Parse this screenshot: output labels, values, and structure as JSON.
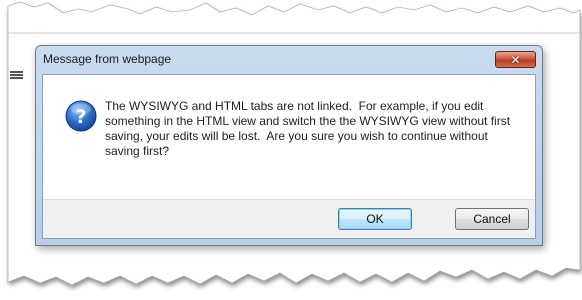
{
  "dialog": {
    "title": "Message from webpage",
    "close_glyph": "✕",
    "icon": "question-icon",
    "message": "The WYSIWYG and HTML tabs are not linked.  For example, if you edit something in the HTML view and switch the the WYSIWYG view without first saving, your edits will be lost.  Are you sure you wish to continue without saving first?",
    "buttons": {
      "ok": "OK",
      "cancel": "Cancel"
    }
  },
  "background": {
    "left_icon": "list-icon"
  },
  "colors": {
    "titlebar": "#c9dbee",
    "close_button": "#c9513a",
    "default_button_border": "#3c7fb1",
    "question_icon": "#1f5fb8"
  }
}
